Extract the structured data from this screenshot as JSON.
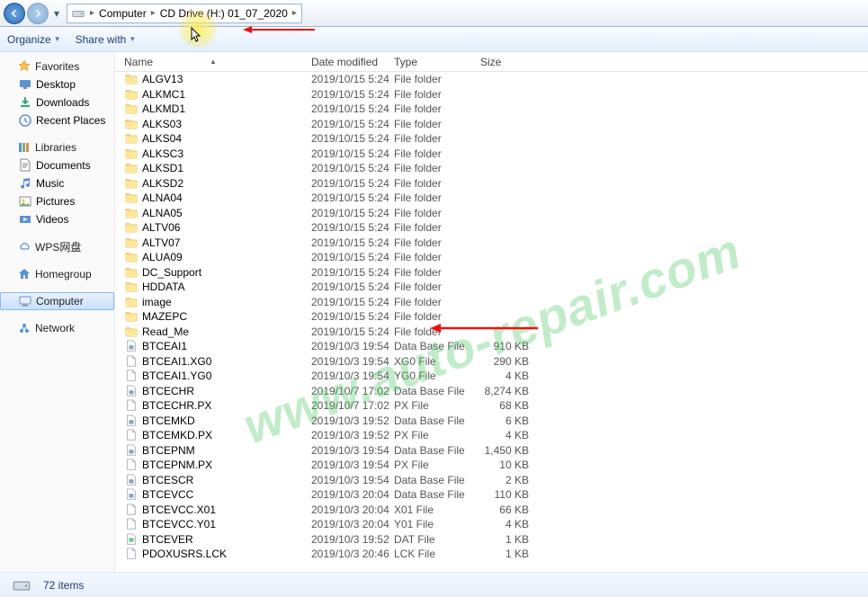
{
  "breadcrumb": {
    "root": "Computer",
    "drive": "CD Drive (H:) 01_07_2020"
  },
  "toolbar": {
    "organize": "Organize",
    "share": "Share with"
  },
  "sidebar": {
    "favorites": {
      "label": "Favorites",
      "items": [
        "Desktop",
        "Downloads",
        "Recent Places"
      ]
    },
    "libraries": {
      "label": "Libraries",
      "items": [
        "Documents",
        "Music",
        "Pictures",
        "Videos"
      ]
    },
    "wps": {
      "label": "WPS网盘"
    },
    "homegroup": {
      "label": "Homegroup"
    },
    "computer": {
      "label": "Computer"
    },
    "network": {
      "label": "Network"
    }
  },
  "columns": {
    "name": "Name",
    "date": "Date modified",
    "type": "Type",
    "size": "Size"
  },
  "files": [
    {
      "name": "ALGV13",
      "date": "2019/10/15 5:24",
      "type": "File folder",
      "size": "",
      "icon": "folder"
    },
    {
      "name": "ALKMC1",
      "date": "2019/10/15 5:24",
      "type": "File folder",
      "size": "",
      "icon": "folder"
    },
    {
      "name": "ALKMD1",
      "date": "2019/10/15 5:24",
      "type": "File folder",
      "size": "",
      "icon": "folder"
    },
    {
      "name": "ALKS03",
      "date": "2019/10/15 5:24",
      "type": "File folder",
      "size": "",
      "icon": "folder"
    },
    {
      "name": "ALKS04",
      "date": "2019/10/15 5:24",
      "type": "File folder",
      "size": "",
      "icon": "folder"
    },
    {
      "name": "ALKSC3",
      "date": "2019/10/15 5:24",
      "type": "File folder",
      "size": "",
      "icon": "folder"
    },
    {
      "name": "ALKSD1",
      "date": "2019/10/15 5:24",
      "type": "File folder",
      "size": "",
      "icon": "folder"
    },
    {
      "name": "ALKSD2",
      "date": "2019/10/15 5:24",
      "type": "File folder",
      "size": "",
      "icon": "folder"
    },
    {
      "name": "ALNA04",
      "date": "2019/10/15 5:24",
      "type": "File folder",
      "size": "",
      "icon": "folder"
    },
    {
      "name": "ALNA05",
      "date": "2019/10/15 5:24",
      "type": "File folder",
      "size": "",
      "icon": "folder"
    },
    {
      "name": "ALTV06",
      "date": "2019/10/15 5:24",
      "type": "File folder",
      "size": "",
      "icon": "folder"
    },
    {
      "name": "ALTV07",
      "date": "2019/10/15 5:24",
      "type": "File folder",
      "size": "",
      "icon": "folder"
    },
    {
      "name": "ALUA09",
      "date": "2019/10/15 5:24",
      "type": "File folder",
      "size": "",
      "icon": "folder"
    },
    {
      "name": "DC_Support",
      "date": "2019/10/15 5:24",
      "type": "File folder",
      "size": "",
      "icon": "folder"
    },
    {
      "name": "HDDATA",
      "date": "2019/10/15 5:24",
      "type": "File folder",
      "size": "",
      "icon": "folder"
    },
    {
      "name": "image",
      "date": "2019/10/15 5:24",
      "type": "File folder",
      "size": "",
      "icon": "folder"
    },
    {
      "name": "MAZEPC",
      "date": "2019/10/15 5:24",
      "type": "File folder",
      "size": "",
      "icon": "folder"
    },
    {
      "name": "Read_Me",
      "date": "2019/10/15 5:24",
      "type": "File folder",
      "size": "",
      "icon": "folder"
    },
    {
      "name": "BTCEAI1",
      "date": "2019/10/3 19:54",
      "type": "Data Base File",
      "size": "910 KB",
      "icon": "db"
    },
    {
      "name": "BTCEAI1.XG0",
      "date": "2019/10/3 19:54",
      "type": "XG0 File",
      "size": "290 KB",
      "icon": "file"
    },
    {
      "name": "BTCEAI1.YG0",
      "date": "2019/10/3 19:54",
      "type": "YG0 File",
      "size": "4 KB",
      "icon": "file"
    },
    {
      "name": "BTCECHR",
      "date": "2019/10/7 17:02",
      "type": "Data Base File",
      "size": "8,274 KB",
      "icon": "db"
    },
    {
      "name": "BTCECHR.PX",
      "date": "2019/10/7 17:02",
      "type": "PX File",
      "size": "68 KB",
      "icon": "file"
    },
    {
      "name": "BTCEMKD",
      "date": "2019/10/3 19:52",
      "type": "Data Base File",
      "size": "6 KB",
      "icon": "db"
    },
    {
      "name": "BTCEMKD.PX",
      "date": "2019/10/3 19:52",
      "type": "PX File",
      "size": "4 KB",
      "icon": "file"
    },
    {
      "name": "BTCEPNM",
      "date": "2019/10/3 19:54",
      "type": "Data Base File",
      "size": "1,450 KB",
      "icon": "db"
    },
    {
      "name": "BTCEPNM.PX",
      "date": "2019/10/3 19:54",
      "type": "PX File",
      "size": "10 KB",
      "icon": "file"
    },
    {
      "name": "BTCESCR",
      "date": "2019/10/3 19:54",
      "type": "Data Base File",
      "size": "2 KB",
      "icon": "db"
    },
    {
      "name": "BTCEVCC",
      "date": "2019/10/3 20:04",
      "type": "Data Base File",
      "size": "110 KB",
      "icon": "db"
    },
    {
      "name": "BTCEVCC.X01",
      "date": "2019/10/3 20:04",
      "type": "X01 File",
      "size": "66 KB",
      "icon": "file"
    },
    {
      "name": "BTCEVCC.Y01",
      "date": "2019/10/3 20:04",
      "type": "Y01 File",
      "size": "4 KB",
      "icon": "file"
    },
    {
      "name": "BTCEVER",
      "date": "2019/10/3 19:52",
      "type": "DAT File",
      "size": "1 KB",
      "icon": "dat"
    },
    {
      "name": "PDOXUSRS.LCK",
      "date": "2019/10/3 20:46",
      "type": "LCK File",
      "size": "1 KB",
      "icon": "file"
    }
  ],
  "status": {
    "count": "72 items"
  },
  "watermark": "www.auto-repair.com"
}
